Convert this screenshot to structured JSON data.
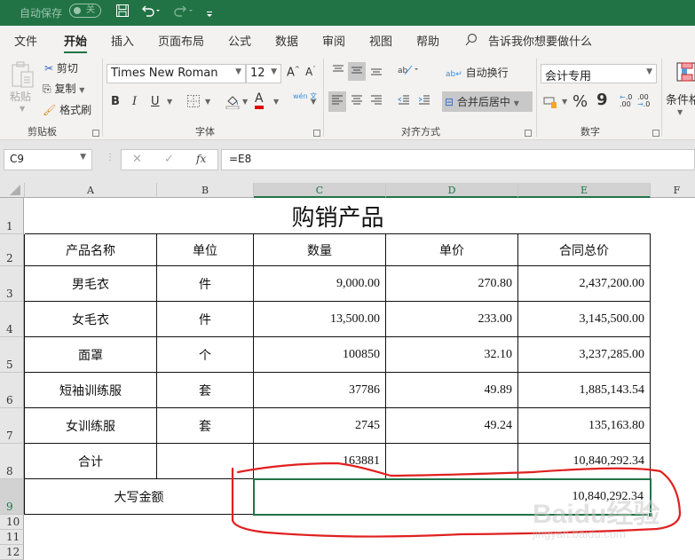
{
  "titlebar": {
    "autosave_label": "自动保存",
    "autosave_state": "关",
    "save_icon": "save-icon",
    "undo_icon": "undo-icon",
    "redo_icon": "redo-icon",
    "customize_icon": "customize-qat-icon"
  },
  "menu": {
    "items": [
      "文件",
      "开始",
      "插入",
      "页面布局",
      "公式",
      "数据",
      "审阅",
      "视图",
      "帮助"
    ],
    "active": "开始",
    "tell_me": "告诉我你想要做什么"
  },
  "ribbon": {
    "clipboard": {
      "paste": "粘贴",
      "cut": "剪切",
      "copy": "复制",
      "format_painter": "格式刷",
      "label": "剪贴板"
    },
    "font": {
      "font_name": "Times New Roman",
      "font_size": "12",
      "bold": "B",
      "italic": "I",
      "underline": "U",
      "font_color_glyph": "A",
      "phonetic": "wén 文",
      "label": "字体",
      "font_color": "#e00000"
    },
    "alignment": {
      "wrap_text": "自动换行",
      "merge_center": "合并后居中",
      "label": "对齐方式"
    },
    "number": {
      "format": "会计专用",
      "percent": "%",
      "comma": "9",
      "label": "数字"
    },
    "styles": {
      "conditional_format": "条件格"
    }
  },
  "formula_bar": {
    "name_box": "C9",
    "cancel": "✕",
    "enter": "✓",
    "fx": "fx",
    "formula": "=E8"
  },
  "sheet": {
    "columns": [
      "A",
      "B",
      "C",
      "D",
      "E",
      "F"
    ],
    "rows": [
      "1",
      "2",
      "3",
      "4",
      "5",
      "6",
      "7",
      "8",
      "9",
      "10",
      "11",
      "12"
    ],
    "title": "购销产品",
    "headers": [
      "产品名称",
      "单位",
      "数量",
      "单价",
      "合同总价"
    ],
    "data": [
      [
        "男毛衣",
        "件",
        "9,000.00",
        "270.80",
        "2,437,200.00"
      ],
      [
        "女毛衣",
        "件",
        "13,500.00",
        "233.00",
        "3,145,500.00"
      ],
      [
        "面罩",
        "个",
        "100850",
        "32.10",
        "3,237,285.00"
      ],
      [
        "短袖训练服",
        "套",
        "37786",
        "49.89",
        "1,885,143.54"
      ],
      [
        "女训练服",
        "套",
        "2745",
        "49.24",
        "135,163.80"
      ]
    ],
    "total_row": [
      "合计",
      "",
      "163881",
      "",
      "10,840,292.34"
    ],
    "capital_row": {
      "label": "大写金额",
      "value": "10,840,292.34"
    },
    "selected_cell": "C9",
    "accent_color": "#217346",
    "annotation_color": "#e02020"
  },
  "watermark": {
    "brand": "Baidu经验",
    "url": "jingyan.baidu.com"
  }
}
